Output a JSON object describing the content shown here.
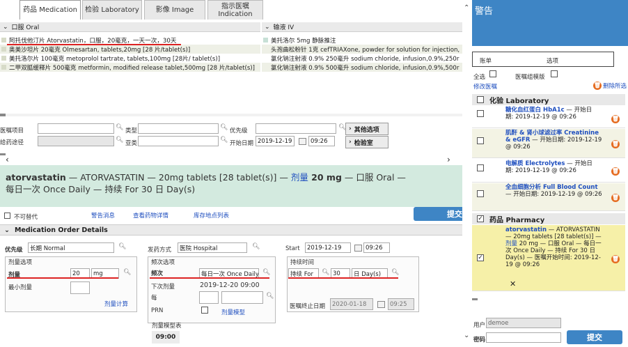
{
  "tabs": [
    "药品 Medication",
    "检验 Laboratory",
    "影像 Image",
    "指示医嘱 Indication"
  ],
  "sections": {
    "oral": "口服 Oral",
    "iv": "输液 IV"
  },
  "oral_rows": [
    "阿托伐他汀片 Atorvastatin，口服，20毫克，一天一次，30天",
    "奥美沙坦片 20毫克 Olmesartan, tablets,20mg [28 片/tablet(s)]",
    "美托洛尔片 100毫克 metoprolol tartrate, tablets,100mg [28片/ tablet(s)]",
    "二甲双胍缓释片 500毫克 metformin, modified release tablet,500mg [28 片/tablet(s)]"
  ],
  "iv_rows": [
    "美托洛尔 5mg 静脉推注",
    "头孢曲松粉针 1克 cefTRIAXone, powder for solution for injection,",
    "氯化钠注射液 0.9% 250毫升 sodium chloride, infusion,0.9%,250r",
    "氯化钠注射液 0.9% 500毫升 sodium chloride, infusion,0.9%,500r"
  ],
  "search_form": {
    "order_item": "医嘱项目",
    "route": "给药途径",
    "type": "类型",
    "subtype": "亚类",
    "priority": "优先级",
    "start_date_label": "开始日期",
    "start_date": "2019-12-19",
    "start_time": "09:26",
    "other_options": "其他选项",
    "lab": "检验室"
  },
  "summary": {
    "drug": "atorvastatin",
    "desc": " — ATORVASTATIN — 20mg tablets [28 tablet(s)] — ",
    "dose_label": "剂量",
    "dose": " 20 mg",
    "route": " — 口服 Oral —",
    "line2": "每日一次 Once Daily — 持续 For 30 日 Day(s)"
  },
  "actions": {
    "no_substitute": "不可替代",
    "warnings": "警告消息",
    "drug_details": "查看药物详情",
    "stock_list": "库存地点列表",
    "submit": "提交"
  },
  "details": {
    "header": "Medication Order Details",
    "priority_label": "优先级",
    "priority": "长期 Normal",
    "dispense_label": "发药方式",
    "dispense": "医院 Hospital",
    "start_label": "Start",
    "start_date": "2019-12-19",
    "start_time": "09:26",
    "dose_opts": "剂量选项",
    "dose_label": "剂量",
    "dose_value": "20",
    "dose_unit": "mg",
    "min_dose": "最小剂量",
    "dose_calc": "剂量计算",
    "freq_opts": "频次选项",
    "freq_label": "频次",
    "freq_value": "每日一次 Once Daily",
    "next_dose_label": "下次剂量",
    "next_dose": "2019-12-20 09:00",
    "each": "每",
    "prn": "PRN",
    "dose_model": "剂量模型",
    "dose_model_table": "剂量模型表",
    "dose_time": "09:00",
    "duration_group": "持续时间",
    "duration_for": "持续 For",
    "duration_value": "30",
    "duration_unit": "日 Day(s)",
    "end_date_label": "医嘱终止日期",
    "end_date": "2020-01-18",
    "end_time": "09:25"
  },
  "alerts": {
    "title": "警告",
    "col_bill": "账单",
    "col_option": "选项",
    "select_all": "全选",
    "order_group": "医嘱组模版",
    "edit_order": "修改医嘱",
    "delete_selected": "删除所选",
    "lab_category": "化验 Laboratory",
    "pharmacy_category": "药品 Pharmacy",
    "lab_items": [
      {
        "name": "糖化血红蛋白 HbA1c",
        "rest": " — 开始日期: 2019-12-19 @ 09:26"
      },
      {
        "name": "肌酐 & 肾小球滤过率 Creatinine & eGFR",
        "rest": " — 开始日期: 2019-12-19 @ 09:26"
      },
      {
        "name": "电解质 Electrolytes",
        "rest": " — 开始日期: 2019-12-19 @ 09:26"
      },
      {
        "name": "全血细胞分析 Full Blood Count",
        "rest": " — 开始日期: 2019-12-19 @ 09:26"
      }
    ],
    "pharmacy_item": {
      "name": "atorvastatin",
      "rest1": " — ATORVASTATIN — 20mg tablets [28 tablet(s)] — ",
      "dose_label": "剂量",
      "rest2": " 20 mg — 口服 Oral — 每日一次 Once Daily — 持续 For 30 日 Day(s) — 医嘱开始时间: 2019-12-19 @ 09:26"
    },
    "user_label": "用户",
    "user": "demoe",
    "password_label": "密码",
    "submit": "提交"
  }
}
